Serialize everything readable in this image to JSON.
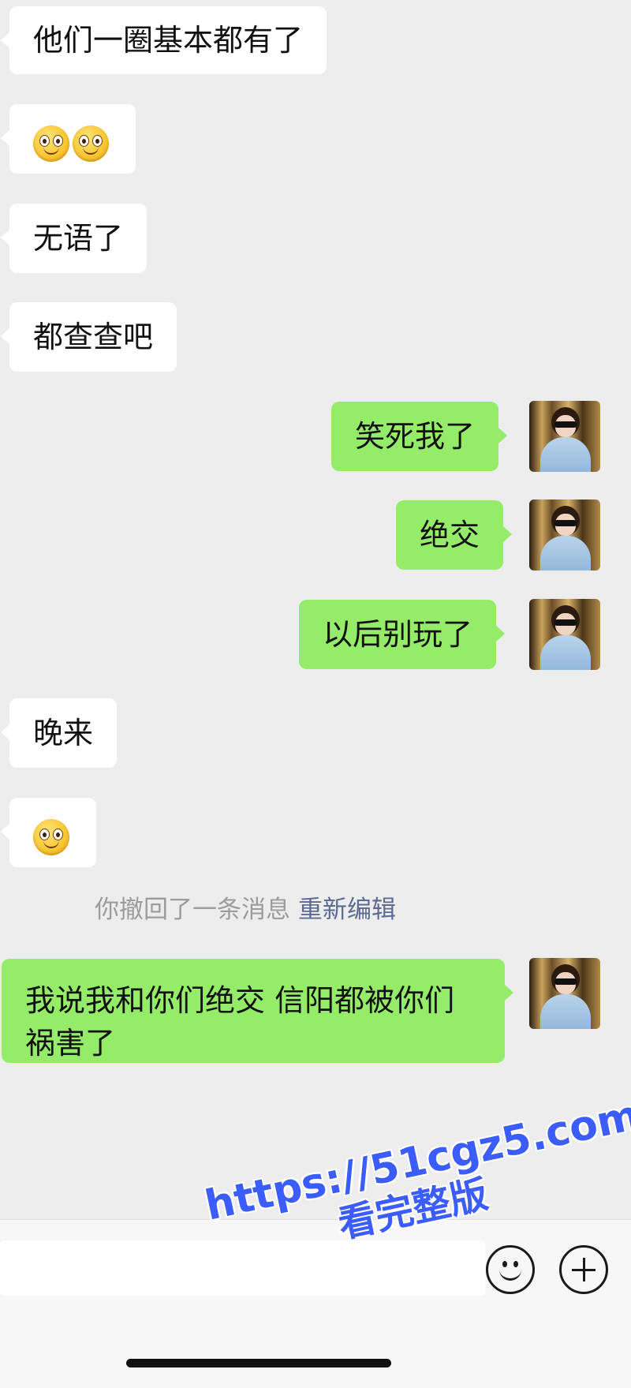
{
  "messages": [
    {
      "side": "left",
      "text": "他们一圈基本都有了"
    },
    {
      "side": "left",
      "emoji": [
        "smile-emoji",
        "smile-emoji"
      ]
    },
    {
      "side": "left",
      "text": "无语了"
    },
    {
      "side": "left",
      "text": "都查查吧"
    },
    {
      "side": "right",
      "text": "笑死我了"
    },
    {
      "side": "right",
      "text": "绝交"
    },
    {
      "side": "right",
      "text": "以后别玩了"
    },
    {
      "side": "left",
      "text": "晚来"
    },
    {
      "side": "left",
      "emoji": [
        "smile-emoji"
      ]
    },
    {
      "side": "right",
      "text": "我说我和你们绝交 信阳都被你们祸害了"
    }
  ],
  "recall_notice": {
    "text": "你撤回了一条消息",
    "action": "重新编辑"
  },
  "input_bar": {
    "emoji_button_icon": "smile-face-icon",
    "plus_button_icon": "plus-circle-icon"
  },
  "watermark": {
    "url": "https://51cgz5.com",
    "subtitle": "看完整版"
  },
  "colors": {
    "background": "#ededed",
    "left_bubble": "#ffffff",
    "right_bubble": "#95ec69",
    "watermark": "#3b5cff"
  }
}
